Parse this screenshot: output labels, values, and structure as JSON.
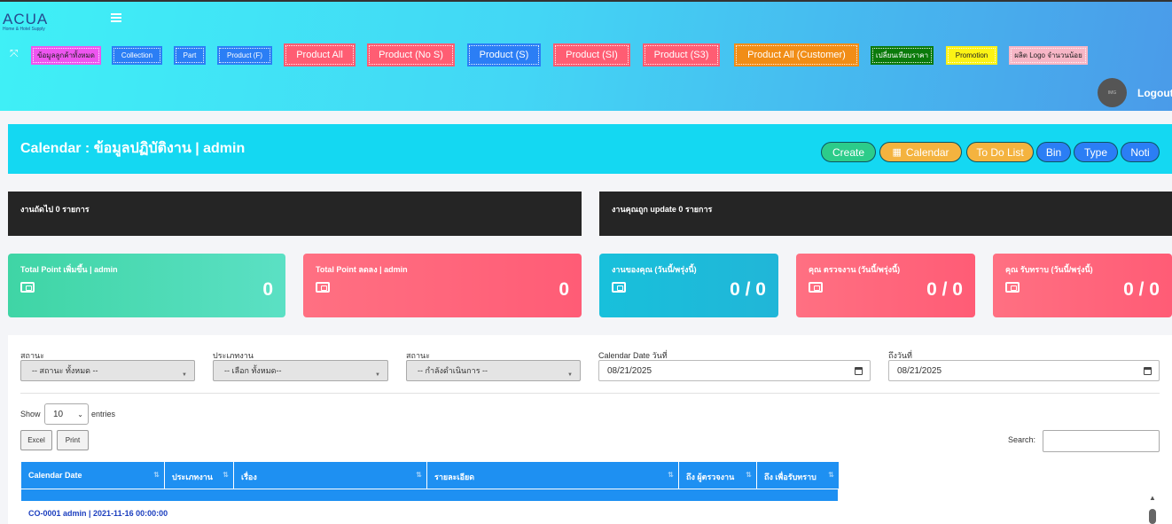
{
  "header": {
    "logo_brand": "ACUA",
    "logo_sub": "Home & Hotel Supply",
    "logout": "Logout",
    "avatar_text": "IMG",
    "nav": [
      {
        "label": "ข้อมูลลูกค้าทั้งหมด",
        "color": "#ee55f0",
        "text_color": "#222"
      },
      {
        "label": "Collection",
        "color": "#2b7ef5",
        "text_color": "#fff"
      },
      {
        "label": "Part",
        "color": "#2b7ef5",
        "text_color": "#fff"
      },
      {
        "label": "Product (F)",
        "color": "#2b7ef5",
        "text_color": "#fff"
      },
      {
        "label": "Product All",
        "color": "#ff5d73",
        "text_color": "#fff"
      },
      {
        "label": "Product (No S)",
        "color": "#ff5d73",
        "text_color": "#fff"
      },
      {
        "label": "Product (S)",
        "color": "#2b7ef5",
        "text_color": "#fff"
      },
      {
        "label": "Product (SI)",
        "color": "#ff5d73",
        "text_color": "#fff"
      },
      {
        "label": "Product (S3)",
        "color": "#ff5d73",
        "text_color": "#fff"
      },
      {
        "label": "Product All (Customer)",
        "color": "#f18d16",
        "text_color": "#fff"
      },
      {
        "label": "เปลี่ยนเทียบราคา",
        "color": "#0b7a0b",
        "text_color": "#fff"
      },
      {
        "label": "Promotion",
        "color": "#fcf315",
        "text_color": "#222"
      },
      {
        "label": "ผลิต Logo จำนวนน้อย",
        "color": "#f7b6c6",
        "text_color": "#222"
      }
    ]
  },
  "calendar": {
    "title": "Calendar : ข้อมูลปฏิบัติงาน | admin",
    "buttons": {
      "create": "Create",
      "calendar": "Calendar",
      "todo": "To Do List",
      "bin": "Bin",
      "type": "Type",
      "noti": "Noti"
    }
  },
  "bars": {
    "next": "งานถัดไป 0 รายการ",
    "updated": "งานคุณถูก update 0 รายการ"
  },
  "cards": [
    {
      "label": "Total Point เพิ่มขึ้น | admin",
      "value": "0"
    },
    {
      "label": "Total Point ลดลง | admin",
      "value": "0"
    },
    {
      "label": "งานของคุณ (วันนี้/พรุ่งนี้)",
      "value": "0 / 0"
    },
    {
      "label": "คุณ ตรวจงาน (วันนี้/พรุ่งนี้)",
      "value": "0 / 0"
    },
    {
      "label": "คุณ รับทราบ (วันนี้/พรุ่งนี้)",
      "value": "0 / 0"
    }
  ],
  "filters": {
    "status_label": "สถานะ",
    "status_value": "-- สถานะ ทั้งหมด --",
    "type_label": "ประเภทงาน",
    "type_value": "-- เลือก ทั้งหมด--",
    "state_label": "สถานะ",
    "state_value": "-- กำลังดำเนินการ --",
    "date_from_label": "Calendar Date วันที่",
    "date_from": "08/21/2025",
    "date_to_label": "ถึงวันที่",
    "date_to": "08/21/2025"
  },
  "table": {
    "show": "Show",
    "entries_value": "10",
    "entries": "entries",
    "excel": "Excel",
    "print": "Print",
    "search": "Search:",
    "columns": [
      "Calendar Date",
      "ประเภทงาน",
      "เรื่อง",
      "รายละเอียด",
      "ถึง ผู้ตรวจงาน",
      "ถึง เพื่อรับทราบ"
    ],
    "first_row": "CO-0001 admin | 2021-11-16 00:00:00"
  }
}
